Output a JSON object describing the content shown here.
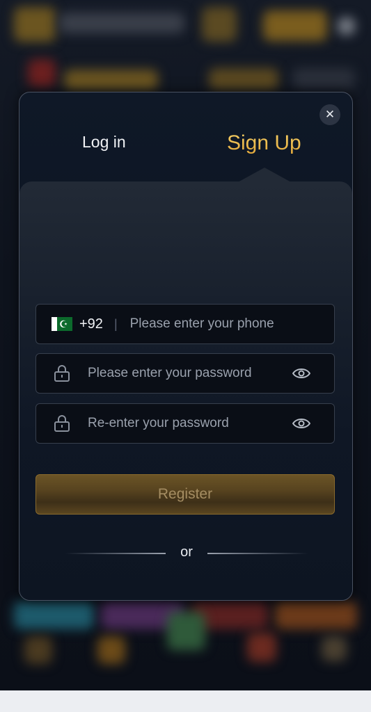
{
  "modal": {
    "close_label": "✕",
    "tabs": {
      "login": "Log in",
      "signup": "Sign Up"
    },
    "phone": {
      "country_code": "+92",
      "separator": "|",
      "placeholder": "Please enter your phone",
      "flag": "pakistan-flag"
    },
    "password": {
      "placeholder": "Please enter your password",
      "icon": "lock-icon",
      "toggle_icon": "eye-icon"
    },
    "repassword": {
      "placeholder": "Re-enter your password",
      "icon": "lock-icon",
      "toggle_icon": "eye-icon"
    },
    "register_label": "Register",
    "or_label": "or"
  },
  "colors": {
    "accent_gold": "#f2c14e",
    "panel_bg": "#0d1522",
    "field_bg": "#0a0e16"
  }
}
